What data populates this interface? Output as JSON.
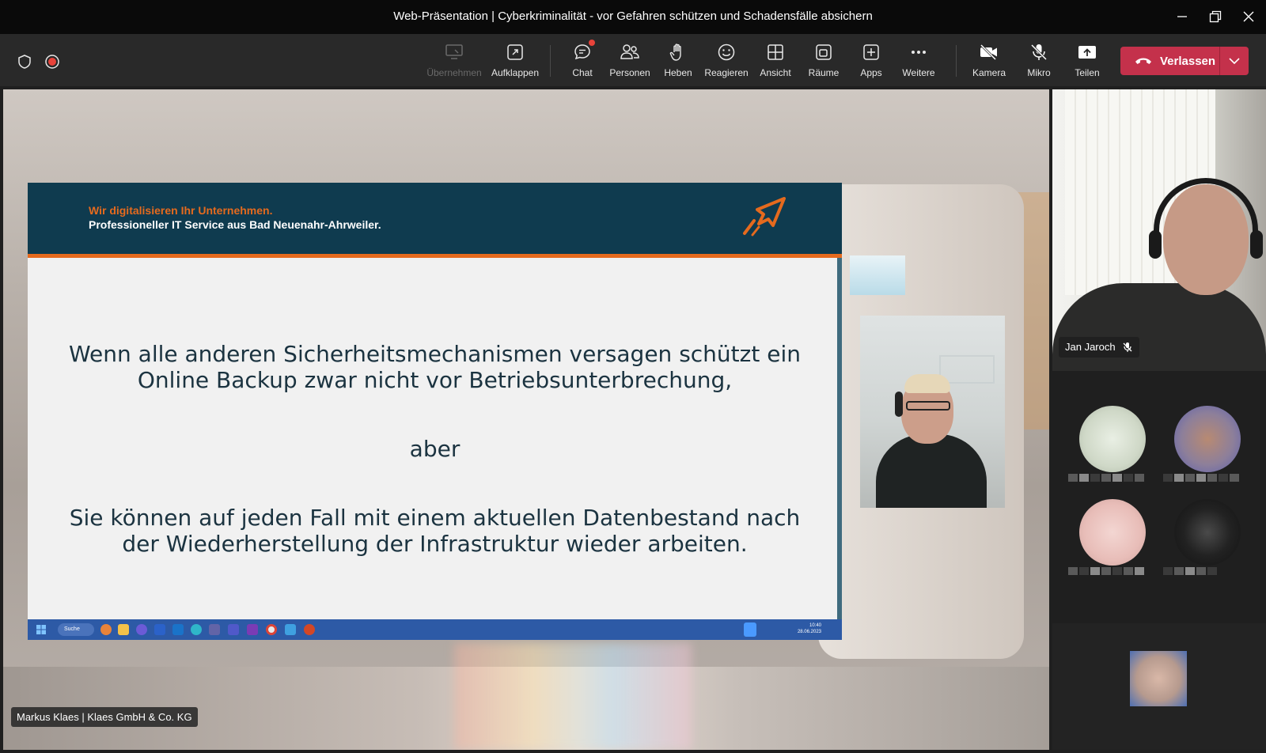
{
  "window": {
    "title": "Web-Präsentation | Cyberkriminalität - vor Gefahren schützen und Schadensfälle absichern"
  },
  "toolbar": {
    "buttons": [
      {
        "label": "Übernehmen",
        "icon": "monitor-icon",
        "disabled": true
      },
      {
        "label": "Aufklappen",
        "icon": "pop-out-icon"
      },
      {
        "label": "Chat",
        "icon": "chat-icon"
      },
      {
        "label": "Personen",
        "icon": "people-icon"
      },
      {
        "label": "Heben",
        "icon": "raise-hand-icon"
      },
      {
        "label": "Reagieren",
        "icon": "smiley-icon"
      },
      {
        "label": "Ansicht",
        "icon": "grid-view-icon"
      },
      {
        "label": "Räume",
        "icon": "rooms-icon"
      },
      {
        "label": "Apps",
        "icon": "apps-plus-icon"
      },
      {
        "label": "Weitere",
        "icon": "more-icon"
      },
      {
        "label": "Kamera",
        "icon": "camera-off-icon"
      },
      {
        "label": "Mikro",
        "icon": "mic-off-icon"
      },
      {
        "label": "Teilen",
        "icon": "share-icon"
      }
    ],
    "leave_label": "Verlassen",
    "colors": {
      "leave": "#c4314b",
      "chat_badge": "#e8433a"
    }
  },
  "slide": {
    "tagline": "Wir digitalisieren Ihr Unternehmen.",
    "subtitle": "Professioneller IT Service aus Bad Neuenahr-Ahrweiler.",
    "paragraph1": "Wenn alle anderen Sicherheitsmechanismen versagen schützt ein Online Backup zwar nicht vor Betriebsunterbrechung,",
    "paragraph2": "aber",
    "paragraph3": "Sie können auf jeden Fall mit einem aktuellen Datenbestand nach der Wiederherstellung der Infrastruktur wieder arbeiten.",
    "taskbar": {
      "search_label": "Suche",
      "time": "10:40",
      "date": "28.06.2023"
    },
    "colors": {
      "header": "#0f3b4f",
      "accent": "#e56a1e"
    }
  },
  "presenter": {
    "nameplate": "Markus Klaes | Klaes GmbH & Co. KG"
  },
  "participants": {
    "featured_name": "Jan Jaroch"
  }
}
